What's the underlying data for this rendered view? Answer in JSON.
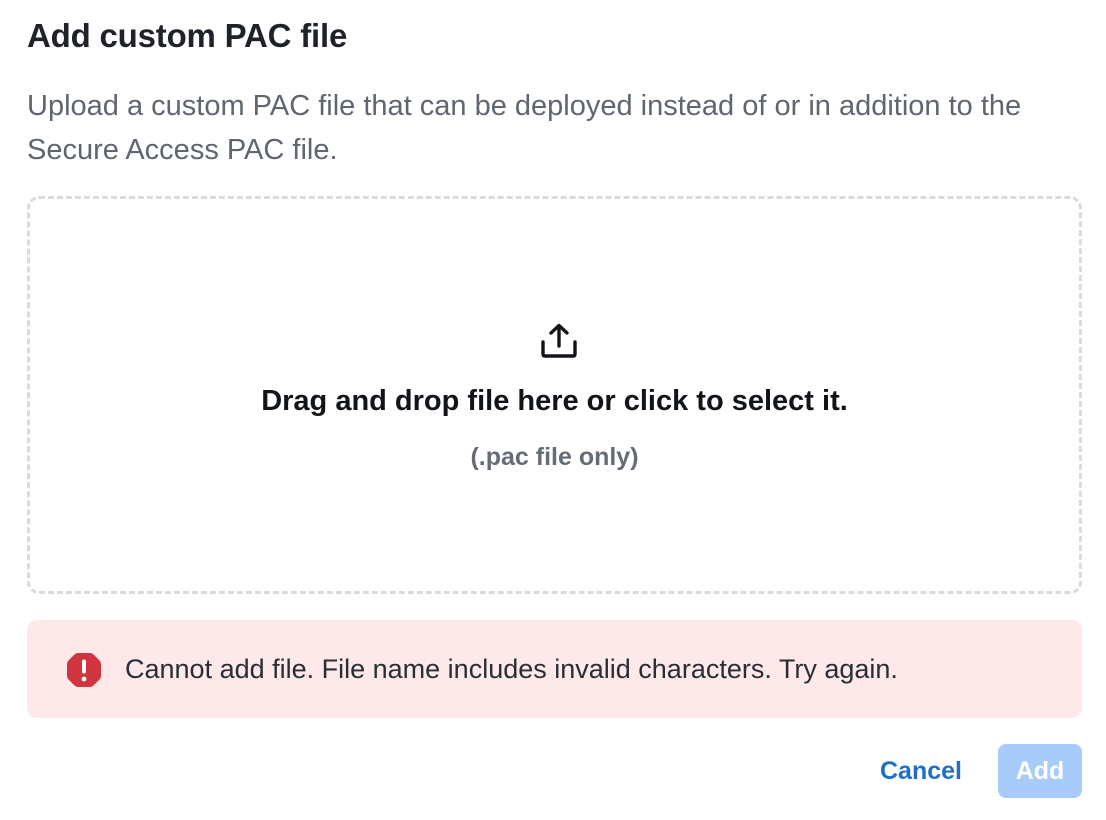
{
  "dialog": {
    "title": "Add custom PAC file",
    "description": "Upload a custom PAC file that can be deployed instead of or in addition to the Secure Access PAC file."
  },
  "dropzone": {
    "icon": "upload-icon",
    "primary_text": "Drag and drop file here or click to select it.",
    "secondary_text": "(.pac file only)"
  },
  "error": {
    "icon": "error-hexagon-icon",
    "message": "Cannot add file. File name includes invalid characters. Try again.",
    "background_color": "#fde8ea",
    "icon_color": "#d0343f"
  },
  "actions": {
    "cancel_label": "Cancel",
    "add_label": "Add",
    "add_disabled": true,
    "link_color": "#1f6fc5",
    "disabled_button_color": "#a8ccfa"
  }
}
